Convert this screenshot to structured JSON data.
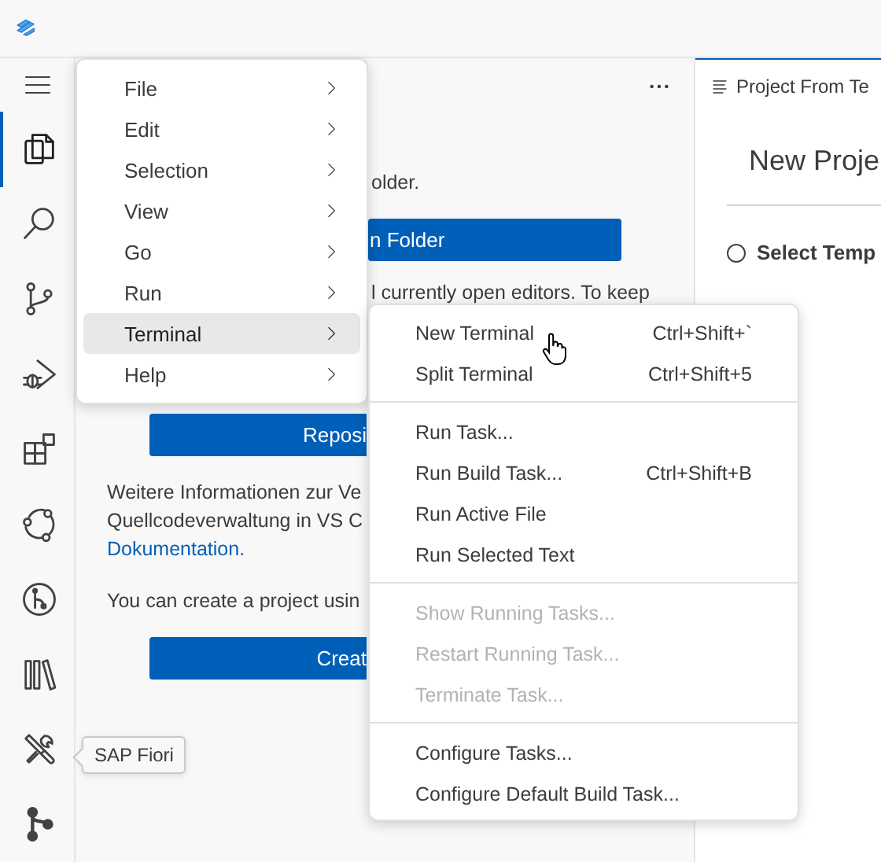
{
  "activity_bar": {
    "items": [
      {
        "selected": true
      },
      {
        "selected": false
      },
      {
        "selected": false
      },
      {
        "selected": false
      },
      {
        "selected": false
      },
      {
        "selected": false
      },
      {
        "selected": false
      },
      {
        "selected": false
      },
      {
        "selected": false
      },
      {
        "selected": false
      }
    ]
  },
  "sidebar": {
    "text_1": "older.",
    "button_1": "n Folder",
    "text_2": "l currently open editors. To keep",
    "button_2": "Reposi",
    "paragraph": {
      "lines": [
        "Weitere Informationen zur Ve",
        "Quellcodeverwaltung in VS C"
      ],
      "link": "Dokumentation."
    },
    "text_3": "You can create a project usin",
    "button_3": "Creat"
  },
  "editor": {
    "tab": {
      "label": "Project From Te",
      "selected": true
    },
    "heading": "New Proje",
    "step": {
      "label": "Select Temp",
      "checked": false
    }
  },
  "menu_bar": {
    "items": [
      {
        "label": "File",
        "selected": false
      },
      {
        "label": "Edit",
        "selected": false
      },
      {
        "label": "Selection",
        "selected": false
      },
      {
        "label": "View",
        "selected": false
      },
      {
        "label": "Go",
        "selected": false
      },
      {
        "label": "Run",
        "selected": false
      },
      {
        "label": "Terminal",
        "selected": true
      },
      {
        "label": "Help",
        "selected": false
      }
    ]
  },
  "terminal_submenu": {
    "groups": [
      [
        {
          "label": "New Terminal",
          "shortcut": "Ctrl+Shift+`",
          "disabled": false
        },
        {
          "label": "Split Terminal",
          "shortcut": "Ctrl+Shift+5",
          "disabled": false
        }
      ],
      [
        {
          "label": "Run Task...",
          "disabled": false
        },
        {
          "label": "Run Build Task...",
          "shortcut": "Ctrl+Shift+B",
          "disabled": false
        },
        {
          "label": "Run Active File",
          "disabled": false
        },
        {
          "label": "Run Selected Text",
          "disabled": false
        }
      ],
      [
        {
          "label": "Show Running Tasks...",
          "disabled": true
        },
        {
          "label": "Restart Running Task...",
          "disabled": true
        },
        {
          "label": "Terminate Task...",
          "disabled": true
        }
      ],
      [
        {
          "label": "Configure Tasks...",
          "disabled": false
        },
        {
          "label": "Configure Default Build Task...",
          "disabled": false
        }
      ]
    ]
  },
  "tooltip": "SAP Fiori"
}
